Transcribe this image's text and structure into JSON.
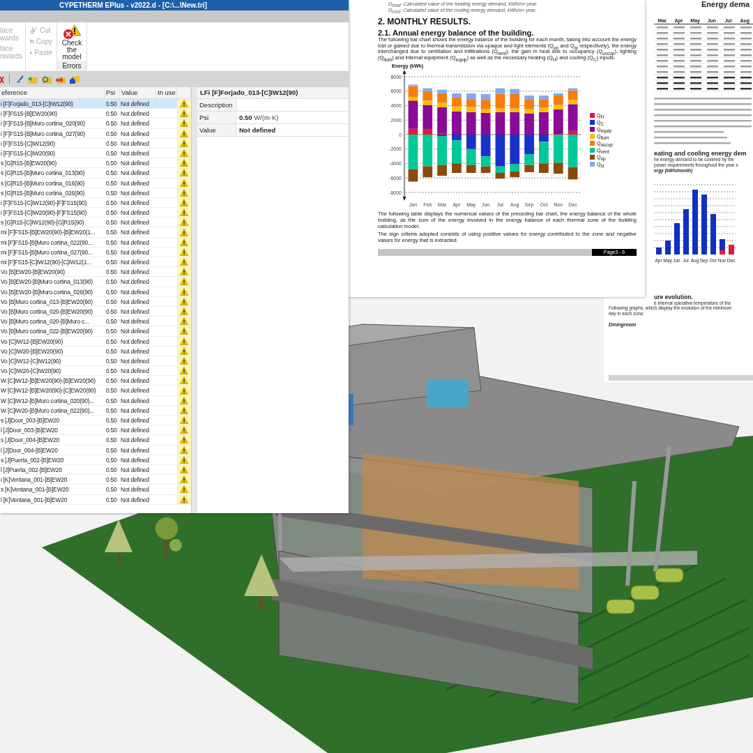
{
  "app": {
    "title": "CYPETHERM EPlus - v2022.d - [C:\\...\\New.tri]",
    "ribbon": {
      "replace_items": [
        {
          "label": "lace wards",
          "disabled": true
        },
        {
          "label": "lace nwards",
          "disabled": true
        }
      ],
      "clipboard": [
        {
          "kind": "cut",
          "label": "Cut",
          "disabled": true
        },
        {
          "kind": "copy",
          "label": "Copy",
          "disabled": true
        },
        {
          "kind": "paste",
          "label": "Paste",
          "disabled": true
        }
      ],
      "check_button": {
        "label": "Check the model"
      },
      "group_label": "Errors"
    },
    "table": {
      "columns": [
        "eference",
        "Psi",
        "Value",
        "In use"
      ],
      "rows": [
        {
          "reference": "i [F]Forjado_013-[C]IW12(90)",
          "psi": "0.50",
          "value": "Not defined",
          "selected": true
        },
        {
          "reference": "i [F]FS15-[B]EW20(90)",
          "psi": "0.50",
          "value": "Not defined",
          "selected": false
        },
        {
          "reference": "i [F]FS15-[B]Muro cortina_020(90)",
          "psi": "0.50",
          "value": "Not defined",
          "selected": false
        },
        {
          "reference": "i [F]FS15-[B]Muro cortina_027(90)",
          "psi": "0.50",
          "value": "Not defined",
          "selected": false
        },
        {
          "reference": "i [F]FS15-[C]IW12(90)",
          "psi": "0.50",
          "value": "Not defined",
          "selected": false
        },
        {
          "reference": "i [F]FS15-[C]IW20(90)",
          "psi": "0.50",
          "value": "Not defined",
          "selected": false
        },
        {
          "reference": "s [G]R15-[B]EW20(90)",
          "psi": "0.50",
          "value": "Not defined",
          "selected": false
        },
        {
          "reference": "s [G]R15-[B]Muro cortina_013(90)",
          "psi": "0.50",
          "value": "Not defined",
          "selected": false
        },
        {
          "reference": "s [G]R15-[B]Muro cortina_016(90)",
          "psi": "0.50",
          "value": "Not defined",
          "selected": false
        },
        {
          "reference": "s [G]R15-[B]Muro cortina_026(90)",
          "psi": "0.50",
          "value": "Not defined",
          "selected": false
        },
        {
          "reference": "i [F]FS15-[C]IW12(90)-[F]FS15(90)",
          "psi": "0.50",
          "value": "Not defined",
          "selected": false
        },
        {
          "reference": "i [F]FS15-[C]IW20(90)-[F]FS15(90)",
          "psi": "0.50",
          "value": "Not defined",
          "selected": false
        },
        {
          "reference": "s [G]R15-[C]IW12(90)-[G]R15(90)",
          "psi": "0.50",
          "value": "Not defined",
          "selected": false
        },
        {
          "reference": "mi [F]FS15-[B]EW20(90)-[B]EW20(1...",
          "psi": "0.50",
          "value": "Not defined",
          "selected": false
        },
        {
          "reference": "mi [F]FS15-[B]Muro cortina_022(90...",
          "psi": "0.50",
          "value": "Not defined",
          "selected": false
        },
        {
          "reference": "mi [F]FS15-[B]Muro cortina_027(90...",
          "psi": "0.50",
          "value": "Not defined",
          "selected": false
        },
        {
          "reference": "mi [F]FS15-[C]IW12(90)-[C]IW12(1...",
          "psi": "0.50",
          "value": "Not defined",
          "selected": false
        },
        {
          "reference": "Vo [B]EW20-[B]EW20(90)",
          "psi": "0.50",
          "value": "Not defined",
          "selected": false
        },
        {
          "reference": "Vo [B]EW20-[B]Muro cortina_013(90)",
          "psi": "0.50",
          "value": "Not defined",
          "selected": false
        },
        {
          "reference": "Vo [B]EW20-[B]Muro cortina_026(90)",
          "psi": "0.50",
          "value": "Not defined",
          "selected": false
        },
        {
          "reference": "Vo [B]Muro cortina_013-[B]EW20(90)",
          "psi": "0.50",
          "value": "Not defined",
          "selected": false
        },
        {
          "reference": "Vo [B]Muro cortina_020-[B]EW20(90)",
          "psi": "0.50",
          "value": "Not defined",
          "selected": false
        },
        {
          "reference": "Vo [B]Muro cortina_020-[B]Muro c...",
          "psi": "0.50",
          "value": "Not defined",
          "selected": false
        },
        {
          "reference": "Vo [B]Muro cortina_022-[B]EW20(90)",
          "psi": "0.50",
          "value": "Not defined",
          "selected": false
        },
        {
          "reference": "Vo [C]IW12-[B]EW20(90)",
          "psi": "0.50",
          "value": "Not defined",
          "selected": false
        },
        {
          "reference": "Vo [C]IW20-[B]EW20(90)",
          "psi": "0.50",
          "value": "Not defined",
          "selected": false
        },
        {
          "reference": "Vo [C]IW12-[C]IW12(90)",
          "psi": "0.50",
          "value": "Not defined",
          "selected": false
        },
        {
          "reference": "Vo [C]IW20-[C]IW20(90)",
          "psi": "0.50",
          "value": "Not defined",
          "selected": false
        },
        {
          "reference": "W [C]IW12-[B]EW20(90)-[B]EW20(90)",
          "psi": "0.50",
          "value": "Not defined",
          "selected": false
        },
        {
          "reference": "W [C]IW12-[B]EW20(90)-[C]EW20(90)",
          "psi": "0.50",
          "value": "Not defined",
          "selected": false
        },
        {
          "reference": "W [C]IW12-[B]Muro cortina_020(90)...",
          "psi": "0.50",
          "value": "Not defined",
          "selected": false
        },
        {
          "reference": "W [C]IW20-[B]Muro cortina_022(90)...",
          "psi": "0.50",
          "value": "Not defined",
          "selected": false
        },
        {
          "reference": "s [J]Door_003-[B]EW20",
          "psi": "0.50",
          "value": "Not defined",
          "selected": false
        },
        {
          "reference": "l [J]Door_003-[B]EW20",
          "psi": "0.50",
          "value": "Not defined",
          "selected": false
        },
        {
          "reference": "s [J]Door_004-[B]EW20",
          "psi": "0.50",
          "value": "Not defined",
          "selected": false
        },
        {
          "reference": "l [J]Door_004-[B]EW20",
          "psi": "0.50",
          "value": "Not defined",
          "selected": false
        },
        {
          "reference": "s [J]Puerta_002-[B]EW20",
          "psi": "0.50",
          "value": "Not defined",
          "selected": false
        },
        {
          "reference": "l [J]Puerta_002-[B]EW20",
          "psi": "0.50",
          "value": "Not defined",
          "selected": false
        },
        {
          "reference": "i [K]Ventana_001-[B]EW20",
          "psi": "0.50",
          "value": "Not defined",
          "selected": false
        },
        {
          "reference": "s [K]Ventana_001-[B]EW20",
          "psi": "0.50",
          "value": "Not defined",
          "selected": false
        },
        {
          "reference": "l [K]Ventana_001-[B]EW20",
          "psi": "0.50",
          "value": "Not defined",
          "selected": false
        }
      ]
    },
    "detail": {
      "title": "LFi [F]Forjado_013-[C]IW12(90)",
      "fields": [
        {
          "label": "Description"
        },
        {
          "label": "Psi",
          "value": "0.50",
          "unit": "W/(m·K)"
        },
        {
          "label": "Value",
          "value": "Not defined"
        }
      ]
    }
  },
  "report_page": {
    "notes": [
      "D$_{heat}$: Calculated value of the heating energy demand, kWh/m²·year.",
      "D$_{cool}$: Calculated value of the cooling energy demand, kWh/m²·year."
    ],
    "heading": "2. MONTHLY RESULTS.",
    "subheading": "2.1. Annual energy balance of the building.",
    "intro": "The following bar chart shows the energy balance of the building for each month, taking into account the energy lost or gained due to thermal transmission via opaque and light elements (Q$_{op}$ and Q$_{sr}$ respectively), the energy interchanged due to ventilation and infiltrations (Q$_{vent}$), the gain in heat due to occupancy (Q$_{occup}$), lighting (Q$_{ilum}$) and internal equipment (Q$_{equip}$) as well as the necessary heating (Q$_{H}$) and cooling (Q$_{C}$) inputs.",
    "chart_data": {
      "type": "bar",
      "ylabel": "Energy (kWh)",
      "stacked": true,
      "grid": true,
      "categories": [
        "Jan",
        "Feb",
        "Mar",
        "Apr",
        "May",
        "Jun",
        "Jul",
        "Aug",
        "Sep",
        "Oct",
        "Nov",
        "Dec"
      ],
      "ylim": [
        -8000,
        8000
      ],
      "yticks": [
        -8000,
        -6000,
        -4000,
        -2000,
        0,
        2000,
        4000,
        6000,
        8000
      ],
      "series": [
        {
          "name": "Q$_{H}$",
          "color": "#e8173c",
          "values": [
            800,
            700,
            200,
            0,
            0,
            0,
            0,
            0,
            0,
            0,
            100,
            500
          ]
        },
        {
          "name": "Q$_{C}$",
          "color": "#1832c8",
          "values": [
            0,
            0,
            -200,
            -800,
            -2000,
            -3000,
            -4400,
            -4100,
            -2700,
            -1000,
            0,
            0
          ]
        },
        {
          "name": "Q$_{equip}$",
          "color": "#8b0a96",
          "values": [
            3900,
            3400,
            3600,
            3200,
            3100,
            3000,
            3100,
            3100,
            2900,
            3100,
            3400,
            3700
          ]
        },
        {
          "name": "Q$_{ilum}$",
          "color": "#f8c000",
          "values": [
            500,
            600,
            600,
            700,
            700,
            500,
            500,
            500,
            600,
            600,
            600,
            600
          ]
        },
        {
          "name": "Q$_{occup}$",
          "color": "#f67d0c",
          "values": [
            1500,
            1300,
            1300,
            1200,
            1100,
            1300,
            2000,
            2000,
            1400,
            1200,
            1300,
            1300
          ]
        },
        {
          "name": "Q$_{vent}$",
          "color": "#00c896",
          "values": [
            -4800,
            -4400,
            -4000,
            -3200,
            -2200,
            -1400,
            -900,
            -1000,
            -1500,
            -3000,
            -3900,
            -4500
          ]
        },
        {
          "name": "Q$_{op}$",
          "color": "#8c4a0a",
          "values": [
            -1700,
            -1500,
            -1500,
            -1300,
            -1100,
            -900,
            -800,
            -800,
            -1000,
            -1300,
            -1500,
            -1700
          ]
        },
        {
          "name": "Q$_{sr}$",
          "color": "#86a8f4",
          "values": [
            200,
            400,
            500,
            600,
            800,
            800,
            800,
            700,
            500,
            500,
            300,
            300
          ]
        }
      ]
    },
    "paragraphs": [
      "The following table displays the numerical values of the preceding bar chart, the energy balance of the whole building, as the sum of the energy involved in the energy balance of each thermal zone of the building calculation model.",
      "The sign criteria adopted consists of using positive values for energy contributed to the zone and negative values for energy that is extracted."
    ],
    "footer": "Page3 - 6"
  },
  "report_page_2": {
    "title": "Energy dema",
    "table": {
      "columns": [
        "Mar",
        "Apr",
        "May",
        "Jun",
        "Jul",
        "Aug"
      ]
    },
    "heading": "eating and cooling energy dem",
    "lines": [
      "he energy demand to be covered by the",
      "power requirements throughout the year s"
    ],
    "chart_caption": "ergy (kWh/month)",
    "month_labels": [
      "Apr",
      "May",
      "Jun",
      "Jul",
      "Aug",
      "Sep",
      "Oct",
      "Nov",
      "Dec"
    ],
    "heading_2": "ure evolution.",
    "line_2": "e internal operative temperature of the",
    "paragraph": "Following graphs, which display the evolution of the minimum",
    "paragraph_end": "day in each zone:",
    "zone": "Diningroom"
  }
}
